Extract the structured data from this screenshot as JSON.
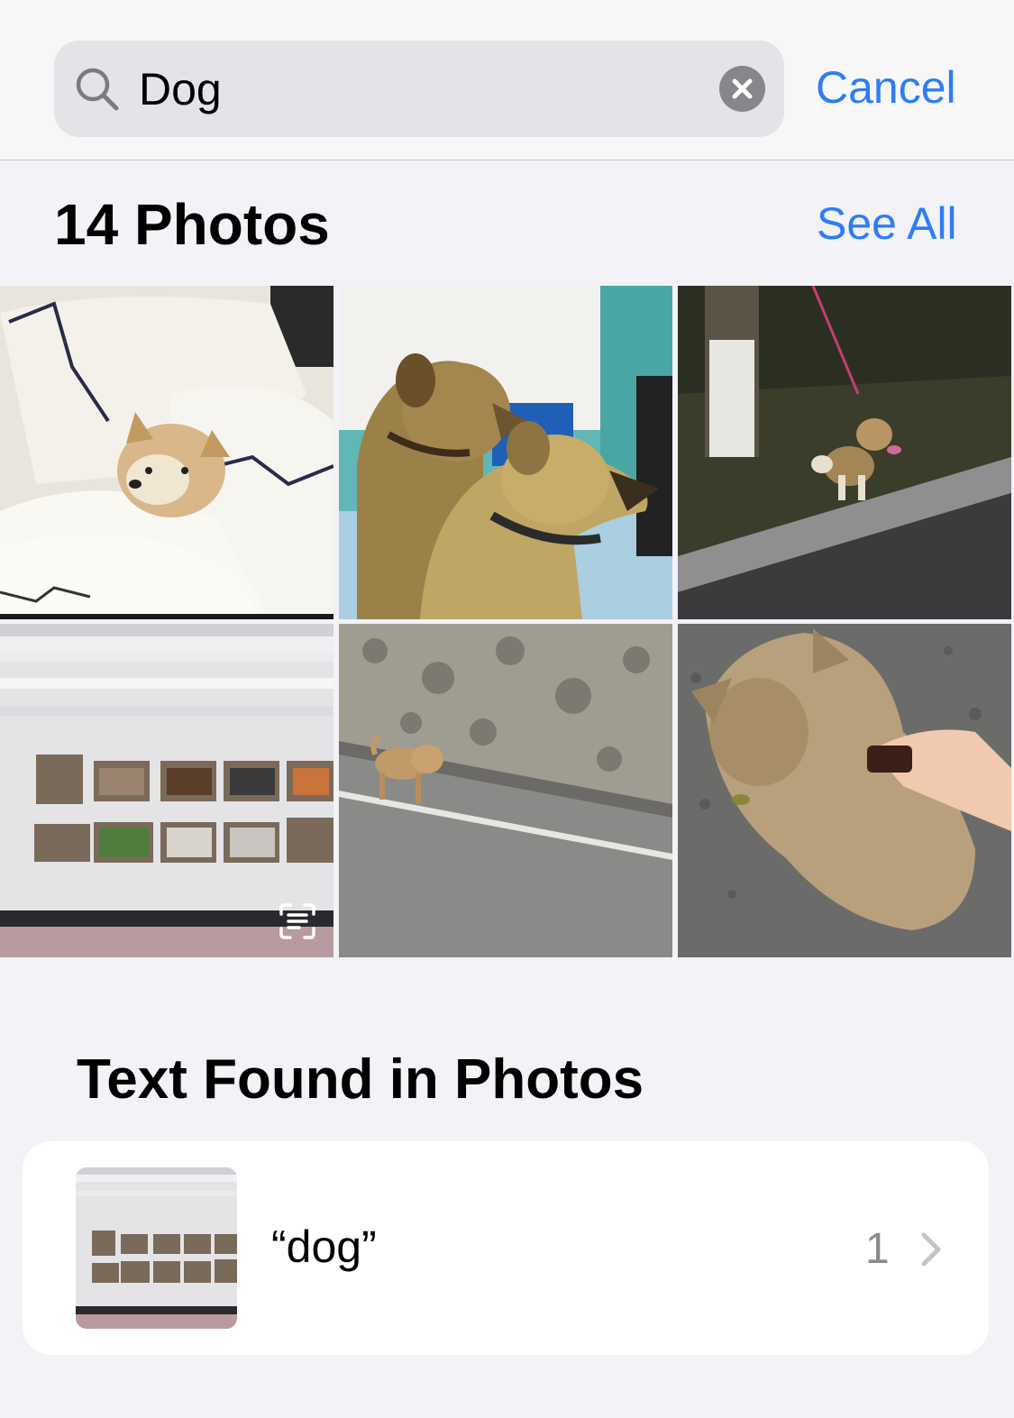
{
  "search": {
    "query": "Dog",
    "cancel_label": "Cancel"
  },
  "photos_section": {
    "title": "14 Photos",
    "see_all_label": "See All",
    "photos": [
      {
        "description_icon": "photo-dog-in-bed"
      },
      {
        "description_icon": "photo-two-dogs"
      },
      {
        "description_icon": "photo-dog-on-leash-night"
      },
      {
        "description_icon": "photo-screen-notebook",
        "has_live_text": true
      },
      {
        "description_icon": "photo-dog-on-road"
      },
      {
        "description_icon": "photo-fluffy-dog-petted"
      }
    ]
  },
  "text_section": {
    "title": "Text Found in Photos",
    "results": [
      {
        "label": "“dog”",
        "count": "1"
      }
    ]
  },
  "colors": {
    "accent": "#2f7cf6",
    "background": "#f2f2f7",
    "search_field": "#e3e3e8"
  }
}
